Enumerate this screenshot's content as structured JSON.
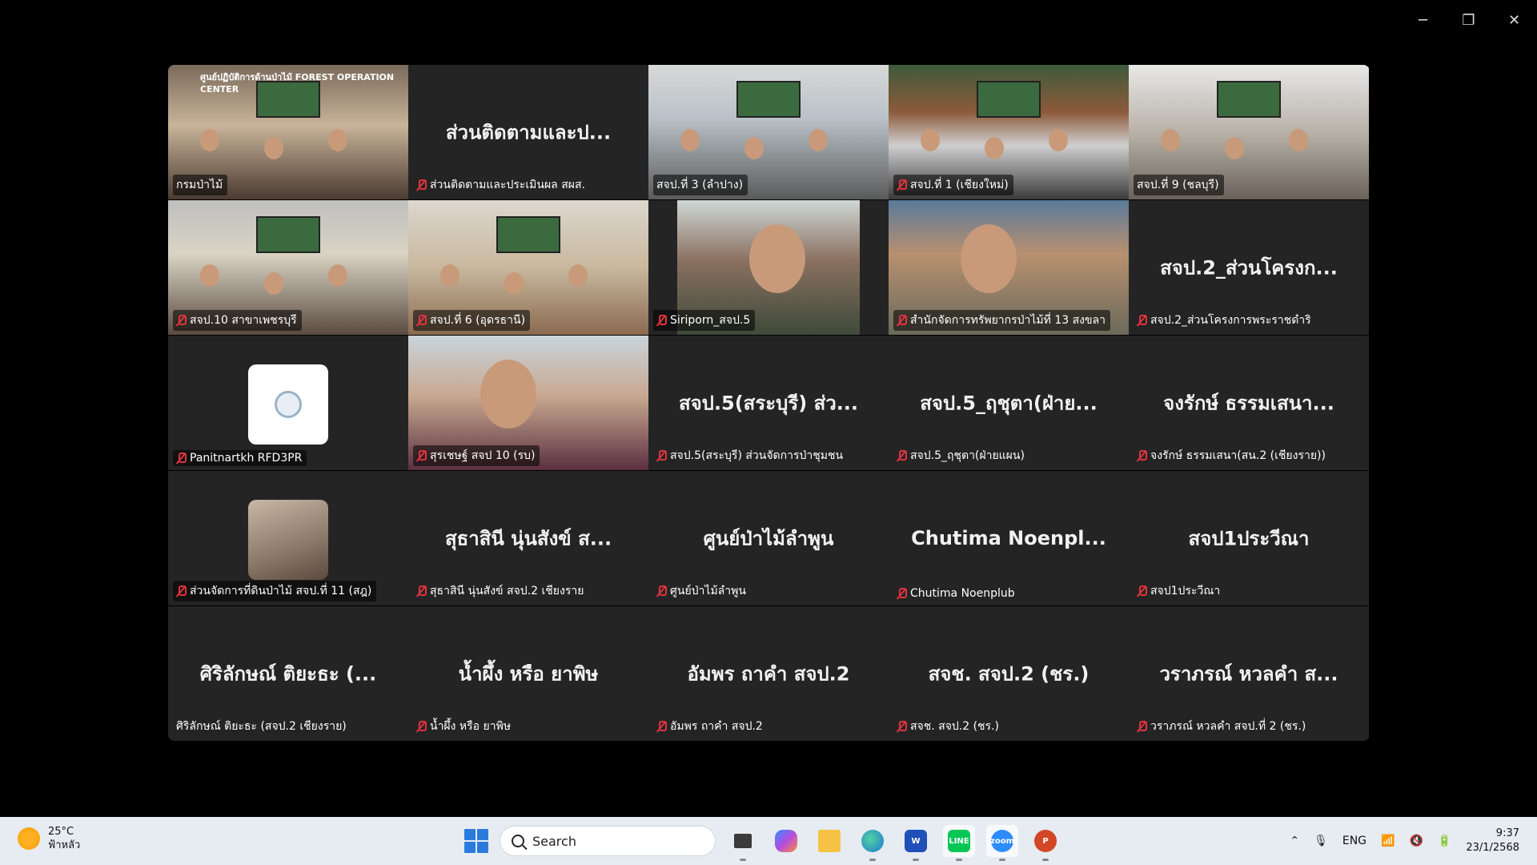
{
  "window": {
    "minimize": "─",
    "restore": "❐",
    "close": "✕"
  },
  "tiles": [
    {
      "id": "t1",
      "big": "",
      "label": "กรมป่าไม้",
      "muted": false,
      "video": "room1",
      "active": true
    },
    {
      "id": "t2",
      "big": "ส่วนติดตามและป...",
      "label": "ส่วนติดตามและประเมินผล สผส.",
      "muted": true
    },
    {
      "id": "t3",
      "big": "",
      "label": "สจป.ที่ 3 (ลำปาง)",
      "muted": false,
      "video": "room2"
    },
    {
      "id": "t4",
      "big": "",
      "label": "สจป.ที่ 1 (เชียงใหม่)",
      "muted": true,
      "video": "room3"
    },
    {
      "id": "t5",
      "big": "",
      "label": "สจป.ที่ 9 (ชลบุรี)",
      "muted": false,
      "video": "room4"
    },
    {
      "id": "t6",
      "big": "",
      "label": "สจป.10 สาขาเพชรบุรี",
      "muted": true,
      "video": "room5"
    },
    {
      "id": "t7",
      "big": "",
      "label": "สจป.ที่ 6 (อุดรธานี)",
      "muted": true,
      "video": "room6"
    },
    {
      "id": "t8",
      "big": "",
      "label": "Siriporn_สจป.5",
      "muted": true,
      "video": "person1"
    },
    {
      "id": "t9",
      "big": "",
      "label": "สำนักจัดการทรัพยากรป่าไม้ที่ 13 สงขลา",
      "muted": true,
      "video": "person2"
    },
    {
      "id": "t10",
      "big": "สจป.2_ส่วนโครงก...",
      "label": "สจป.2_ส่วนโครงการพระราชดำริ",
      "muted": true
    },
    {
      "id": "t11",
      "big": "",
      "label": "Panitnartkh RFD3PR",
      "muted": true,
      "avatar": "logo"
    },
    {
      "id": "t12",
      "big": "",
      "label": "สุรเชษฐ์ สจป 10 (รบ)",
      "muted": true,
      "video": "person3"
    },
    {
      "id": "t13",
      "big": "สจป.5(สระบุรี) ส่ว...",
      "label": "สจป.5(สระบุรี) ส่วนจัดการป่าชุมชน",
      "muted": true
    },
    {
      "id": "t14",
      "big": "สจป.5_ฤชุตา(ฝ่าย...",
      "label": "สจป.5_ฤชุตา(ฝ่ายแผน)",
      "muted": true
    },
    {
      "id": "t15",
      "big": "จงรักษ์ ธรรมเสนา...",
      "label": "จงรักษ์ ธรรมเสนา(สน.2 (เชียงราย))",
      "muted": true
    },
    {
      "id": "t16",
      "big": "",
      "label": "ส่วนจัดการที่ดินป่าไม้ สจป.ที่ 11 (สฎ)",
      "muted": true,
      "avatar": "cat"
    },
    {
      "id": "t17",
      "big": "สุธาสินี นุ่นสังข์ ส...",
      "label": "สุธาสินี นุ่นสังข์ สจป.2 เชียงราย",
      "muted": true
    },
    {
      "id": "t18",
      "big": "ศูนย์ป่าไม้ลำพูน",
      "label": "ศูนย์ป่าไม้ลำพูน",
      "muted": true
    },
    {
      "id": "t19",
      "big": "Chutima  Noenpl...",
      "label": "Chutima Noenplub",
      "muted": true
    },
    {
      "id": "t20",
      "big": "สจป1ประวีณา",
      "label": "สจป1ประวีณา",
      "muted": true
    },
    {
      "id": "t21",
      "big": "ศิริลักษณ์ ติยะธะ (...",
      "label": "ศิริลักษณ์ ติยะธะ (สจป.2 เชียงราย)",
      "muted": false
    },
    {
      "id": "t22",
      "big": "น้ำผึ้ง หรือ ยาพิษ",
      "label": "น้ำผึ้ง หรือ ยาพิษ",
      "muted": true
    },
    {
      "id": "t23",
      "big": "อัมพร ถาคำ สจป.2",
      "label": "อัมพร ถาคำ สจป.2",
      "muted": true
    },
    {
      "id": "t24",
      "big": "สจช. สจป.2 (ชร.)",
      "label": "สจช. สจป.2 (ชร.)",
      "muted": true
    },
    {
      "id": "t25",
      "big": "วราภรณ์ หวลคำ ส...",
      "label": "วราภรณ์ หวลคำ สจป.ที่ 2 (ชร.)",
      "muted": true
    }
  ],
  "tile1_sign": "ศูนย์ปฏิบัติการด้านป่าไม้ FOREST OPERATION CENTER",
  "taskbar": {
    "weather_temp": "25°C",
    "weather_desc": "ฟ้าหลัว",
    "search_label": "Search",
    "apps": [
      "Task View",
      "Copilot",
      "File Explorer",
      "Edge",
      "Word",
      "LINE",
      "Zoom",
      "PowerPoint"
    ],
    "language": "ENG",
    "time": "9:37",
    "date": "23/1/2568"
  }
}
